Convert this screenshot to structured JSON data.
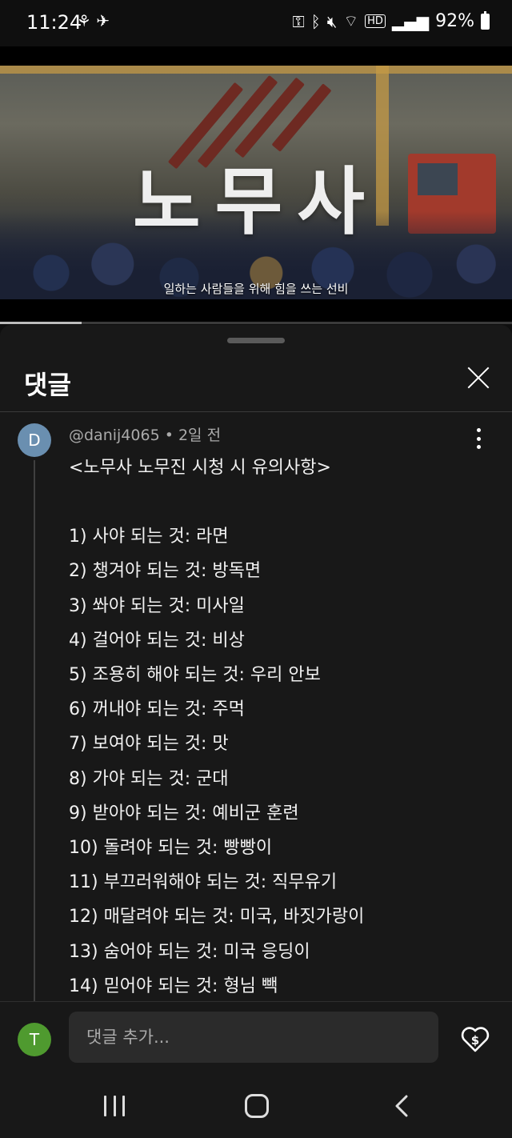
{
  "status_bar": {
    "time": "11:24",
    "left_icons": "⚘ ✈",
    "battery": "92%"
  },
  "video": {
    "title": "노무사",
    "subtitle": "일하는 사람들을 위해 힘을 쓰는 선비",
    "progress_fraction": 0.16
  },
  "comments_panel": {
    "title": "댓글",
    "comment": {
      "avatar_letter": "D",
      "author": "@danij4065",
      "separator": " • ",
      "time": "2일 전",
      "heading": "<노무사 노무진 시청 시 유의사항>",
      "lines": [
        "1) 사야 되는 것: 라면",
        "2) 챙겨야 되는 것: 방독면",
        "3) 쏴야 되는 것: 미사일",
        "4) 걸어야 되는 것: 비상",
        "5) 조용히 해야 되는 것: 우리 안보",
        "6) 꺼내야 되는 것: 주먹",
        "7) 보여야 되는 것: 맛",
        "8) 가야 되는 것: 군대",
        "9) 받아야 되는 것: 예비군 훈련",
        "10) 돌려야 되는 것: 빵빵이",
        "11) 부끄러워해야 되는 것: 직무유기",
        "12) 매달려야 되는 것: 미국, 바짓가랑이",
        "13) 숨어야 되는 것: 미국 응딩이",
        "14) 믿어야 되는 것: 형님 빽"
      ]
    },
    "add_comment": {
      "avatar_letter": "T",
      "placeholder": "댓글 추가..."
    }
  },
  "icons": {
    "close": "close-icon",
    "more": "more-vert-icon",
    "thanks": "heart-dollar-icon",
    "nav_recents": "recents-icon",
    "nav_home": "home-icon",
    "nav_back": "back-icon"
  },
  "colors": {
    "background": "#0f0f0f",
    "sheet": "#181818",
    "commenter_avatar": "#6a8fb0",
    "user_avatar": "#4f9a2f"
  }
}
